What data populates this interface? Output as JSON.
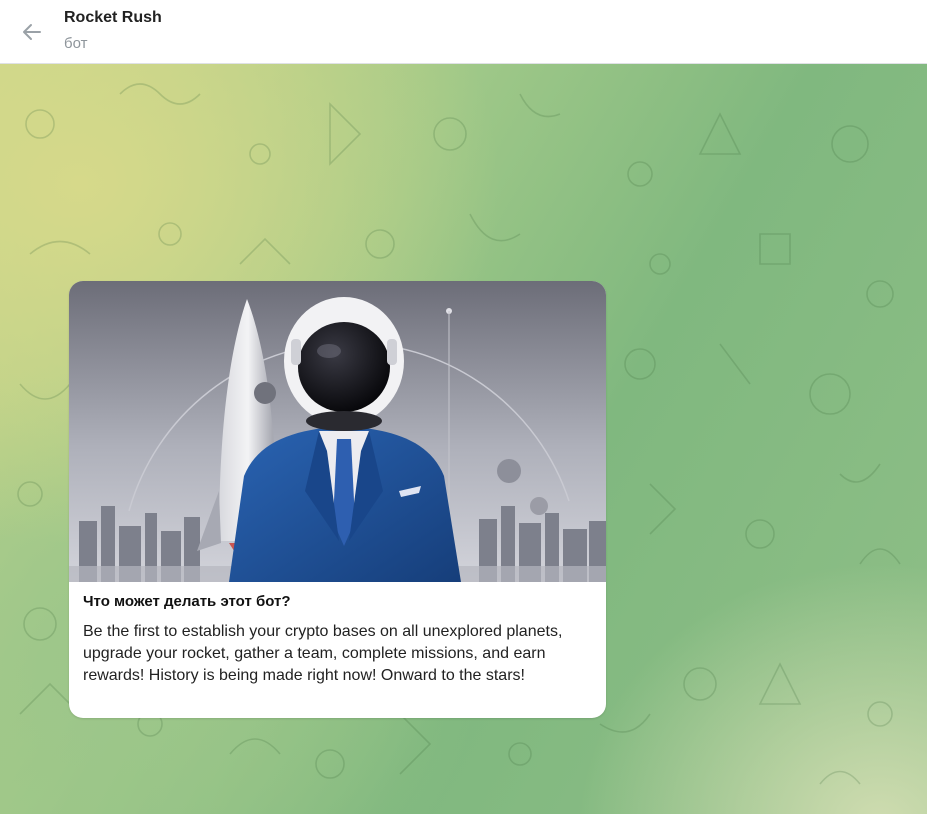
{
  "header": {
    "title": "Rocket Rush",
    "subtitle": "бот"
  },
  "message": {
    "heading": "Что может делать этот бот?",
    "body": "Be the first to establish your crypto bases on all unexplored planets, upgrade your rocket, gather a team, complete missions, and earn rewards! History is being made right now! Onward to the stars!"
  },
  "icons": {
    "back": "arrow-left-icon"
  },
  "colors": {
    "header_bg": "#ffffff",
    "chat_bg_start": "#c9d68a",
    "chat_bg_end": "#80b87f",
    "suit": "#1f4f93"
  }
}
